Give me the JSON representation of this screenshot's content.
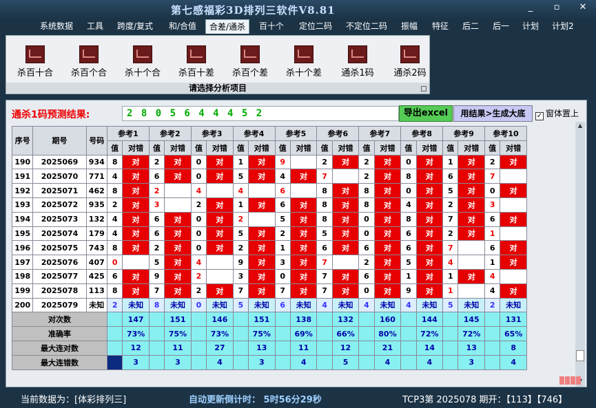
{
  "window": {
    "title": "第七感福彩3D排列三软件V8.81",
    "controls": [
      "_",
      "▫",
      "✕"
    ]
  },
  "menu": [
    "系统数据",
    "工具",
    "跨度/复式",
    "和/合值",
    "合差/通杀",
    "百十个",
    "定位二码",
    "不定位二码",
    "振幅",
    "特征",
    "后二",
    "后一",
    "计划",
    "计划2"
  ],
  "menu_active_index": 4,
  "ribbon": {
    "buttons": [
      "杀百十合",
      "杀百个合",
      "杀十个合",
      "杀百十差",
      "杀百个差",
      "杀十个差",
      "通杀1码",
      "通杀2码"
    ],
    "caption": "请选择分析项目"
  },
  "prediction": {
    "label": "通杀1码预测结果:",
    "value": "2 8 0 5 6 4 4 4 5 2",
    "export_label": "导出excel",
    "generate_label": "用结果>生成大底",
    "pin_label": "窗体置上",
    "pin_checked": true
  },
  "table": {
    "headers": {
      "seq": "序号",
      "issue": "期号",
      "number": "号码",
      "refs": [
        "参考1",
        "参考2",
        "参考3",
        "参考4",
        "参考5",
        "参考6",
        "参考7",
        "参考8",
        "参考9",
        "参考10"
      ],
      "value": "值",
      "check": "对错"
    },
    "rows": [
      {
        "seq": "190",
        "issue": "2025069",
        "num": "934",
        "vals": [
          "8",
          "2",
          "0",
          "1",
          "9",
          "2",
          "2",
          "0",
          "1",
          "2"
        ],
        "hits": [
          1,
          1,
          1,
          1,
          0,
          1,
          1,
          1,
          1,
          1
        ],
        "red": [
          0,
          0,
          0,
          0,
          1,
          0,
          0,
          0,
          0,
          0
        ]
      },
      {
        "seq": "191",
        "issue": "2025070",
        "num": "771",
        "vals": [
          "4",
          "6",
          "0",
          "5",
          "4",
          "7",
          "2",
          "8",
          "6",
          "7"
        ],
        "hits": [
          1,
          1,
          1,
          1,
          1,
          0,
          1,
          1,
          1,
          0
        ],
        "red": [
          0,
          0,
          0,
          0,
          0,
          1,
          0,
          0,
          0,
          1
        ]
      },
      {
        "seq": "192",
        "issue": "2025071",
        "num": "462",
        "vals": [
          "8",
          "2",
          "4",
          "4",
          "6",
          "8",
          "8",
          "0",
          "5",
          "0"
        ],
        "hits": [
          1,
          0,
          0,
          0,
          0,
          1,
          1,
          1,
          1,
          1
        ],
        "red": [
          0,
          1,
          1,
          1,
          1,
          0,
          0,
          0,
          0,
          0
        ]
      },
      {
        "seq": "193",
        "issue": "2025072",
        "num": "935",
        "vals": [
          "2",
          "3",
          "2",
          "1",
          "6",
          "8",
          "8",
          "4",
          "2",
          "3"
        ],
        "hits": [
          1,
          0,
          1,
          1,
          1,
          1,
          1,
          1,
          1,
          0
        ],
        "red": [
          0,
          1,
          0,
          0,
          0,
          0,
          0,
          0,
          0,
          1
        ]
      },
      {
        "seq": "194",
        "issue": "2025073",
        "num": "132",
        "vals": [
          "4",
          "6",
          "0",
          "2",
          "5",
          "8",
          "0",
          "8",
          "7",
          "6"
        ],
        "hits": [
          1,
          1,
          1,
          0,
          1,
          1,
          1,
          1,
          1,
          1
        ],
        "red": [
          0,
          0,
          0,
          1,
          0,
          0,
          0,
          0,
          0,
          0
        ]
      },
      {
        "seq": "195",
        "issue": "2025074",
        "num": "179",
        "vals": [
          "4",
          "6",
          "0",
          "5",
          "2",
          "5",
          "0",
          "6",
          "2",
          "1"
        ],
        "hits": [
          1,
          1,
          1,
          1,
          1,
          1,
          1,
          1,
          1,
          0
        ],
        "red": [
          0,
          0,
          0,
          0,
          0,
          0,
          0,
          0,
          0,
          1
        ]
      },
      {
        "seq": "196",
        "issue": "2025075",
        "num": "743",
        "vals": [
          "8",
          "2",
          "0",
          "2",
          "1",
          "6",
          "6",
          "6",
          "7",
          "6"
        ],
        "hits": [
          1,
          1,
          1,
          1,
          1,
          1,
          1,
          1,
          0,
          1
        ],
        "red": [
          0,
          0,
          0,
          0,
          0,
          0,
          0,
          0,
          1,
          0
        ]
      },
      {
        "seq": "197",
        "issue": "2025076",
        "num": "407",
        "vals": [
          "0",
          "5",
          "4",
          "9",
          "3",
          "7",
          "2",
          "5",
          "4",
          "1"
        ],
        "hits": [
          0,
          1,
          0,
          1,
          1,
          0,
          1,
          1,
          0,
          1
        ],
        "red": [
          1,
          0,
          1,
          0,
          0,
          1,
          0,
          0,
          1,
          0
        ]
      },
      {
        "seq": "198",
        "issue": "2025077",
        "num": "425",
        "vals": [
          "6",
          "9",
          "2",
          "3",
          "0",
          "7",
          "6",
          "1",
          "1",
          "4"
        ],
        "hits": [
          1,
          1,
          0,
          1,
          1,
          1,
          1,
          1,
          1,
          0
        ],
        "red": [
          0,
          0,
          1,
          0,
          0,
          0,
          0,
          0,
          0,
          1
        ]
      },
      {
        "seq": "199",
        "issue": "2025078",
        "num": "113",
        "vals": [
          "8",
          "7",
          "2",
          "7",
          "7",
          "7",
          "0",
          "9",
          "1",
          "4"
        ],
        "hits": [
          1,
          1,
          1,
          1,
          1,
          1,
          1,
          1,
          0,
          1
        ],
        "red": [
          0,
          0,
          0,
          0,
          0,
          0,
          0,
          0,
          1,
          0
        ]
      }
    ],
    "future": {
      "seq": "200",
      "issue": "2025079",
      "num": "未知",
      "vals": [
        "2",
        "8",
        "0",
        "5",
        "6",
        "4",
        "4",
        "4",
        "5",
        "2"
      ],
      "unknown": "未知"
    },
    "stats": [
      {
        "label": "对次数",
        "vals": [
          "147",
          "151",
          "146",
          "151",
          "138",
          "132",
          "160",
          "144",
          "145",
          "131"
        ]
      },
      {
        "label": "准确率",
        "vals": [
          "73%",
          "75%",
          "73%",
          "75%",
          "69%",
          "66%",
          "80%",
          "72%",
          "72%",
          "65%"
        ]
      },
      {
        "label": "最大连对数",
        "vals": [
          "12",
          "11",
          "27",
          "13",
          "11",
          "12",
          "21",
          "14",
          "13",
          "8"
        ]
      },
      {
        "label": "最大连错数",
        "vals": [
          "3",
          "3",
          "4",
          "3",
          "4",
          "5",
          "4",
          "4",
          "3",
          "4"
        ]
      }
    ]
  },
  "status": {
    "current_data": "当前数据为：[体彩排列三]",
    "auto_update": "自动更新倒计时：  5时56分29秒",
    "tcp": "TCP3第  2025078  期开：【113】【746】"
  },
  "colors": {
    "hit": "#e60000",
    "stat_bg": "#88f0f0",
    "accent_title": "#c8e0ff"
  }
}
